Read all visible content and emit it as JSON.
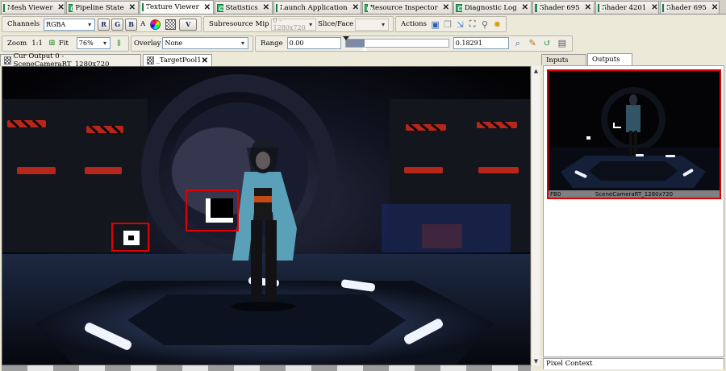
{
  "top_tabs": [
    {
      "label": "Mesh Viewer"
    },
    {
      "label": "Pipeline State"
    },
    {
      "label": "Texture Viewer"
    },
    {
      "label": "Statistics"
    },
    {
      "label": "Launch Application"
    },
    {
      "label": "Resource Inspector"
    },
    {
      "label": "Diagnostic Log"
    },
    {
      "label": "Shader 695"
    },
    {
      "label": "Shader 4201"
    },
    {
      "label": "Shader 695"
    }
  ],
  "active_top_tab": "Texture Viewer",
  "toolbar1": {
    "channels_label": "Channels",
    "channels_value": "RGBA",
    "r": "R",
    "g": "G",
    "b": "B",
    "a": "A",
    "v": "V",
    "subresource_label": "Subresource",
    "mip_label": "Mip",
    "mip_value": "0 - 1280x720",
    "slice_label": "Slice/Face",
    "slice_value": "",
    "actions_label": "Actions"
  },
  "toolbar2": {
    "zoom_label": "Zoom",
    "zoom_1to1": "1:1",
    "fit_label": "Fit",
    "zoom_value": "76%",
    "overlay_label": "Overlay",
    "overlay_value": "None",
    "range_label": "Range",
    "range_min": "0.00",
    "range_max": "0.18291",
    "range_fraction": 0.18
  },
  "doc_tabs": [
    {
      "label": "Cur Output 0 - SceneCameraRT_1280x720"
    },
    {
      "label": "_TargetPool1"
    }
  ],
  "right_panel": {
    "tabs": [
      {
        "label": "Inputs"
      },
      {
        "label": "Outputs"
      }
    ],
    "active_tab": "Outputs",
    "thumb_slot": "FB0",
    "thumb_name": "SceneCameraRT_1280x720",
    "pixel_context_label": "Pixel Context"
  },
  "colors": {
    "highlight": "#e00000",
    "accent_green": "#3cb371"
  },
  "icons": [
    "tab-icon",
    "close-icon",
    "color-wheel-icon",
    "checkerboard-icon",
    "fit-icon",
    "flip-icon",
    "save-icon",
    "copy-icon",
    "open-icon",
    "goto-icon",
    "link-icon",
    "settings-icon",
    "zoom-range-icon",
    "pick-icon",
    "auto-fit-icon",
    "histogram-icon"
  ]
}
